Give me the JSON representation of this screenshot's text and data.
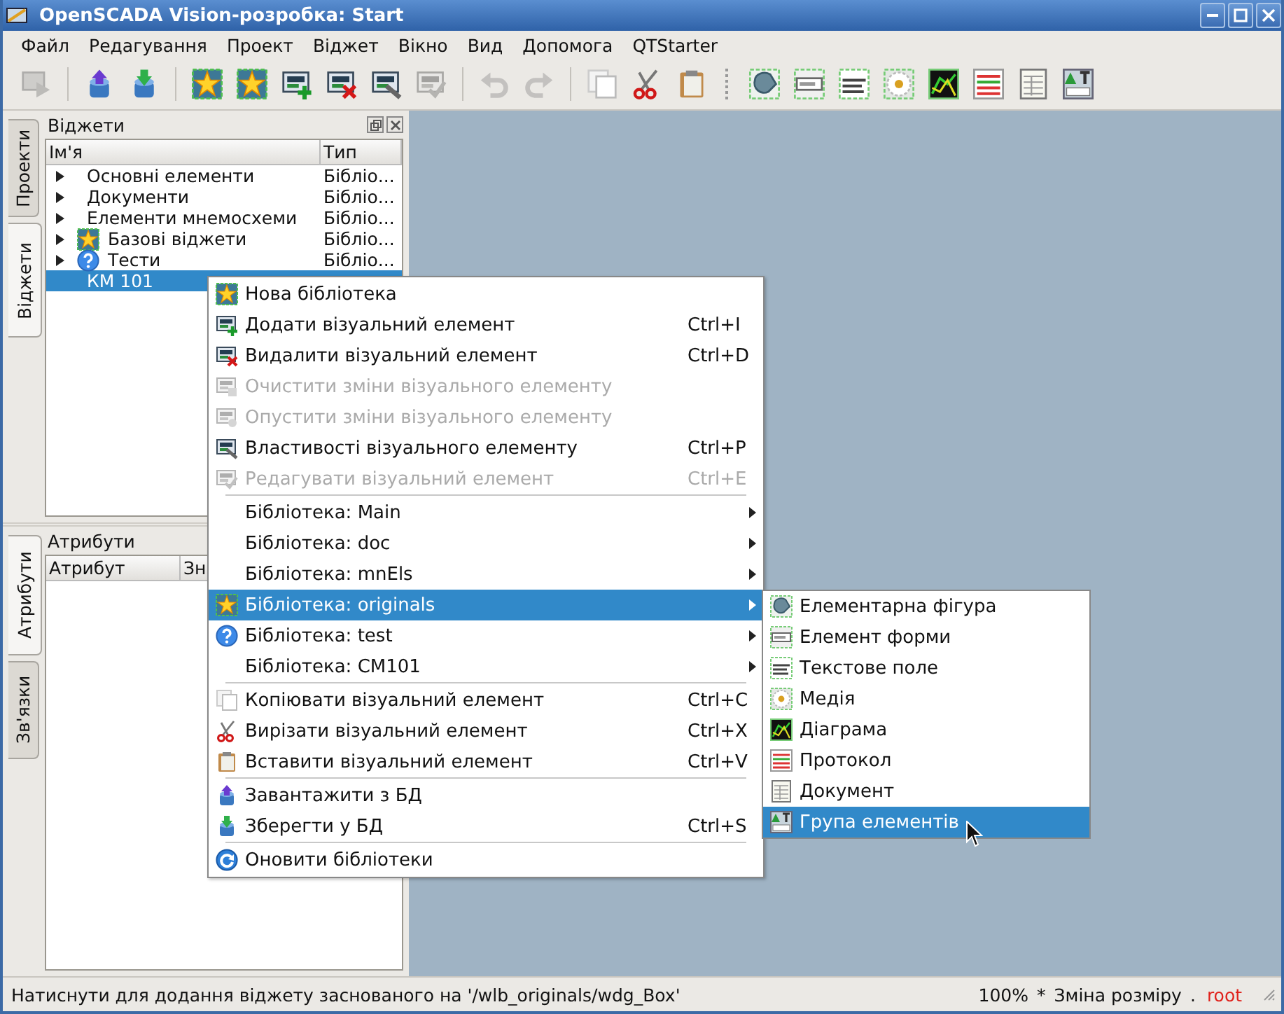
{
  "window": {
    "title": "OpenSCADA Vision-розробка: Start"
  },
  "menu_bar": [
    "Файл",
    "Редагування",
    "Проект",
    "Віджет",
    "Вікно",
    "Вид",
    "Допомога",
    "QTStarter"
  ],
  "toolbar": [
    {
      "kind": "run",
      "disabled": true
    },
    {
      "kind": "separator"
    },
    {
      "kind": "loaddb",
      "disabled": false
    },
    {
      "kind": "savedb",
      "disabled": false
    },
    {
      "kind": "separator"
    },
    {
      "kind": "star",
      "disabled": false
    },
    {
      "kind": "stargrid",
      "disabled": false
    },
    {
      "kind": "add",
      "disabled": false
    },
    {
      "kind": "delete",
      "disabled": false
    },
    {
      "kind": "props",
      "disabled": false
    },
    {
      "kind": "edit",
      "disabled": true
    },
    {
      "kind": "separator"
    },
    {
      "kind": "undo",
      "disabled": true
    },
    {
      "kind": "redo",
      "disabled": true
    },
    {
      "kind": "separator"
    },
    {
      "kind": "copy",
      "disabled": false
    },
    {
      "kind": "cut",
      "disabled": false
    },
    {
      "kind": "paste",
      "disabled": false
    },
    {
      "kind": "handle"
    },
    {
      "kind": "shape",
      "disabled": false
    },
    {
      "kind": "form",
      "disabled": false
    },
    {
      "kind": "text",
      "disabled": false
    },
    {
      "kind": "media",
      "disabled": false
    },
    {
      "kind": "chart",
      "disabled": false
    },
    {
      "kind": "protocol",
      "disabled": false
    },
    {
      "kind": "document",
      "disabled": false
    },
    {
      "kind": "group",
      "disabled": false
    }
  ],
  "left_tabs_top": [
    {
      "label": "Проекти",
      "selected": false
    },
    {
      "label": "Віджети",
      "selected": true
    }
  ],
  "widgets_panel": {
    "title": "Віджети",
    "columns": [
      "Ім'я",
      "Тип"
    ],
    "rows": [
      {
        "kind": "plain",
        "name": "Основні елементи",
        "type": "Бібліо...",
        "expandable": true,
        "selected": false
      },
      {
        "kind": "plain",
        "name": "Документи",
        "type": "Бібліо...",
        "expandable": true,
        "selected": false
      },
      {
        "kind": "plain",
        "name": "Елементи мнемосхеми",
        "type": "Бібліо...",
        "expandable": true,
        "selected": false
      },
      {
        "kind": "star",
        "name": "Базові віджети",
        "type": "Бібліо...",
        "expandable": true,
        "selected": false
      },
      {
        "kind": "help",
        "name": "Тести",
        "type": "Бібліо...",
        "expandable": true,
        "selected": false
      },
      {
        "kind": "plain",
        "name": "КМ 101",
        "expandable": false,
        "selected": true
      }
    ]
  },
  "left_tabs_bottom": [
    {
      "label": "Атрибути",
      "selected": true
    },
    {
      "label": "Зв'язки",
      "selected": false
    }
  ],
  "attributes_panel": {
    "title": "Атрибути",
    "columns": [
      "Атрибут",
      "Зн"
    ]
  },
  "context_menu": [
    {
      "kind": "star",
      "label": "Нова бібліотека",
      "has_submenu": false,
      "disabled": false,
      "selected": false
    },
    {
      "kind": "add",
      "label": "Додати візуальний елемент",
      "shortcut": "Ctrl+I",
      "has_submenu": false,
      "disabled": false,
      "selected": false
    },
    {
      "kind": "delete",
      "label": "Видалити візуальний елемент",
      "shortcut": "Ctrl+D",
      "has_submenu": false,
      "disabled": false,
      "selected": false
    },
    {
      "kind": "clear",
      "label": "Очистити зміни візуального елементу",
      "has_submenu": false,
      "disabled": true,
      "selected": false
    },
    {
      "kind": "revert",
      "label": "Опустити зміни візуального елементу",
      "has_submenu": false,
      "disabled": true,
      "selected": false
    },
    {
      "kind": "props",
      "label": "Властивості візуального елементу",
      "shortcut": "Ctrl+P",
      "has_submenu": false,
      "disabled": false,
      "selected": false
    },
    {
      "kind": "edit",
      "label": "Редагувати візуальний елемент",
      "shortcut": "Ctrl+E",
      "has_submenu": false,
      "disabled": true,
      "selected": false
    },
    {
      "kind": "separator"
    },
    {
      "kind": "plain",
      "label": "Бібліотека: Main",
      "has_submenu": true,
      "disabled": false,
      "selected": false
    },
    {
      "kind": "plain",
      "label": "Бібліотека: doc",
      "has_submenu": true,
      "disabled": false,
      "selected": false
    },
    {
      "kind": "plain",
      "label": "Бібліотека: mnEls",
      "has_submenu": true,
      "disabled": false,
      "selected": false
    },
    {
      "kind": "star",
      "label": "Бібліотека: originals",
      "has_submenu": true,
      "disabled": false,
      "selected": true
    },
    {
      "kind": "help",
      "label": "Бібліотека: test",
      "has_submenu": true,
      "disabled": false,
      "selected": false
    },
    {
      "kind": "plain",
      "label": "Бібліотека: CM101",
      "has_submenu": true,
      "disabled": false,
      "selected": false
    },
    {
      "kind": "separator"
    },
    {
      "kind": "copy",
      "label": "Копіювати візуальний елемент",
      "shortcut": "Ctrl+C",
      "has_submenu": false,
      "disabled": false,
      "selected": false
    },
    {
      "kind": "cut",
      "label": "Вирізати візуальний елемент",
      "shortcut": "Ctrl+X",
      "has_submenu": false,
      "disabled": false,
      "selected": false
    },
    {
      "kind": "paste",
      "label": "Вставити візуальний елемент",
      "shortcut": "Ctrl+V",
      "has_submenu": false,
      "disabled": false,
      "selected": false
    },
    {
      "kind": "separator"
    },
    {
      "kind": "loaddb",
      "label": "Завантажити з БД",
      "has_submenu": false,
      "disabled": false,
      "selected": false
    },
    {
      "kind": "savedb",
      "label": "Зберегти у БД",
      "shortcut": "Ctrl+S",
      "has_submenu": false,
      "disabled": false,
      "selected": false
    },
    {
      "kind": "separator"
    },
    {
      "kind": "refresh",
      "label": "Оновити бібліотеки",
      "has_submenu": false,
      "disabled": false,
      "selected": false
    }
  ],
  "submenu": [
    {
      "kind": "shape",
      "label": "Елементарна фігура",
      "selected": false
    },
    {
      "kind": "form",
      "label": "Елемент форми",
      "selected": false
    },
    {
      "kind": "text",
      "label": "Текстове поле",
      "selected": false
    },
    {
      "kind": "media",
      "label": "Медія",
      "selected": false
    },
    {
      "kind": "chart",
      "label": "Діаграма",
      "selected": false
    },
    {
      "kind": "protocol",
      "label": "Протокол",
      "selected": false
    },
    {
      "kind": "document",
      "label": "Документ",
      "selected": false
    },
    {
      "kind": "group",
      "label": "Група елементів",
      "selected": true
    }
  ],
  "status_bar": {
    "message": "Натиснути для додання віджету заснованого на '/wlb_originals/wdg_Box'",
    "zoom": "100%",
    "modified": "*",
    "mode": "Зміна розміру",
    "dot": ".",
    "user": "root"
  }
}
